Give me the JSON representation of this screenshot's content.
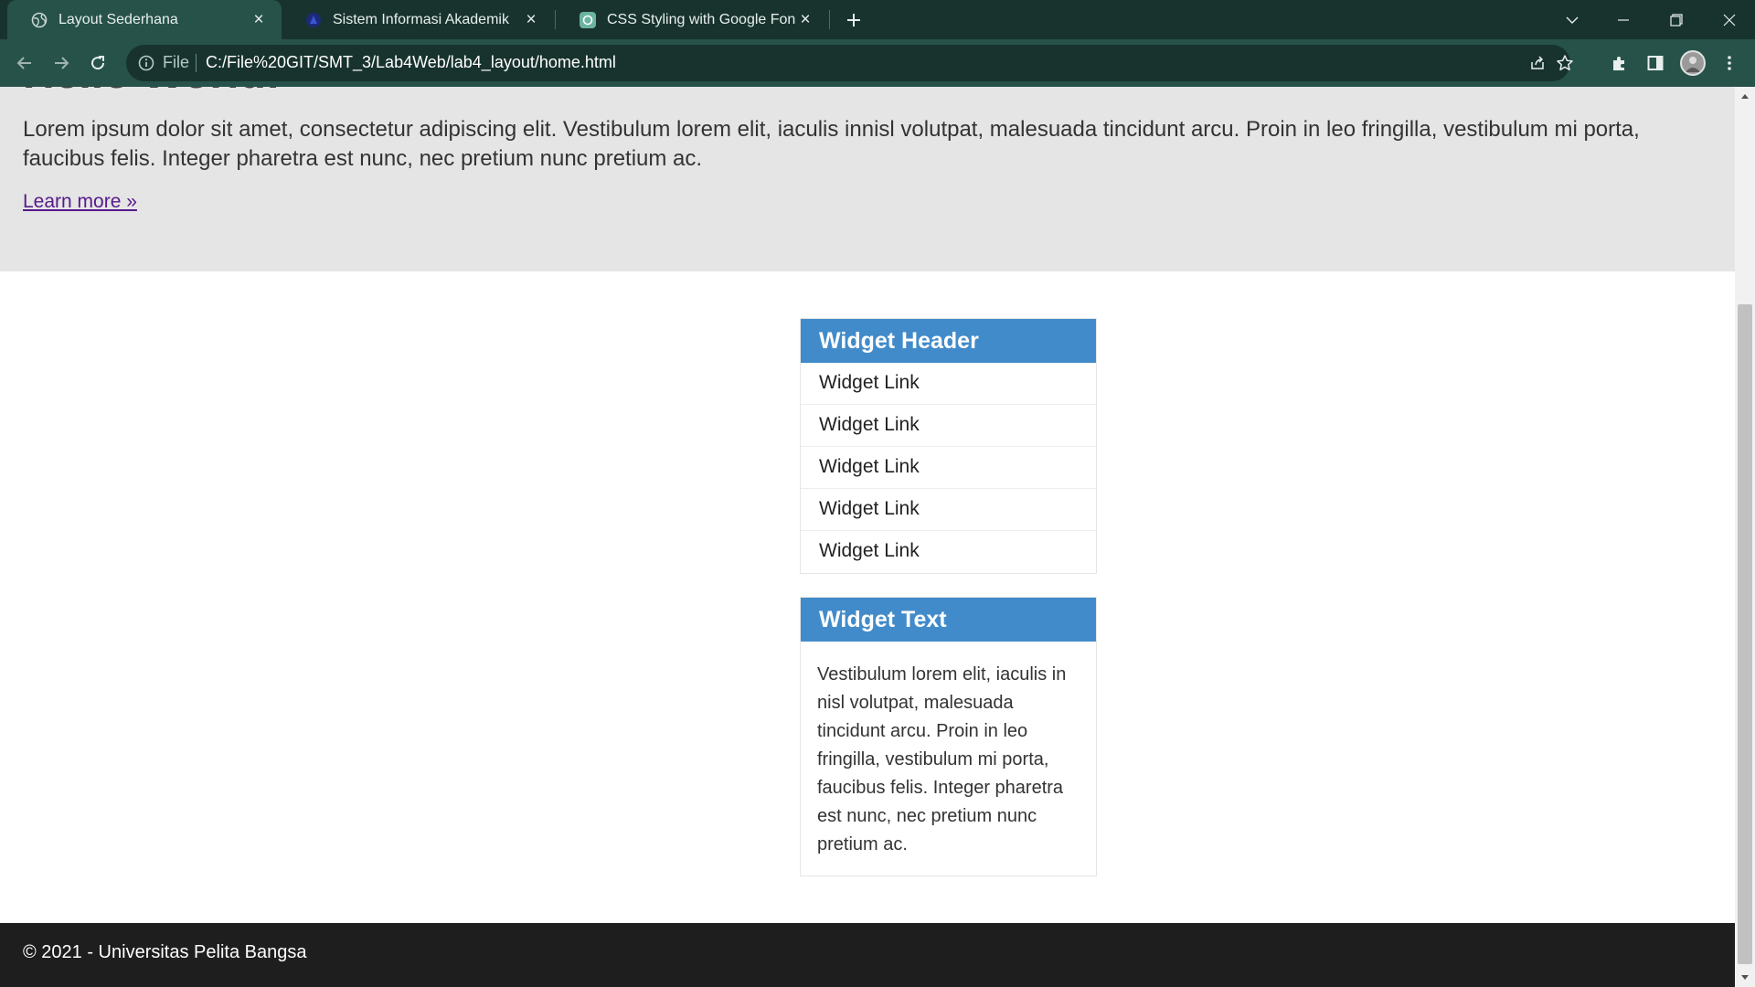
{
  "browser": {
    "tabs": [
      {
        "title": "Layout Sederhana",
        "active": true,
        "icon": "globe-icon"
      },
      {
        "title": "Sistem Informasi Akademik",
        "active": false,
        "icon": "campus-logo-icon"
      },
      {
        "title": "CSS Styling with Google Fonts",
        "active": false,
        "icon": "openai-icon"
      }
    ],
    "address": {
      "scheme_label": "File",
      "url": "C:/File%20GIT/SMT_3/Lab4Web/lab4_layout/home.html"
    }
  },
  "page": {
    "hero": {
      "heading": "Hello World!",
      "text": "Lorem ipsum dolor sit amet, consectetur adipiscing elit. Vestibulum lorem elit, iaculis innisl volutpat, malesuada tincidunt arcu. Proin in leo fringilla, vestibulum mi porta, faucibus felis. Integer pharetra est nunc, nec pretium nunc pretium ac.",
      "link": "Learn more »"
    },
    "widgets": {
      "links_widget": {
        "header": "Widget Header",
        "links": [
          "Widget Link",
          "Widget Link",
          "Widget Link",
          "Widget Link",
          "Widget Link"
        ]
      },
      "text_widget": {
        "header": "Widget Text",
        "body": "Vestibulum lorem elit, iaculis in nisl volutpat, malesuada tincidunt arcu. Proin in leo fringilla, vestibulum mi porta, faucibus felis. Integer pharetra est nunc, nec pretium nunc pretium ac."
      }
    },
    "footer": {
      "text": "© 2021 - Universitas Pelita Bangsa"
    }
  },
  "colors": {
    "chrome_dark": "#18332e",
    "chrome_toolbar": "#26524a",
    "widget_header": "#428bca",
    "hero_bg": "#e5e5e5",
    "footer_bg": "#1e1e1e",
    "visited_link": "#551a8b"
  }
}
